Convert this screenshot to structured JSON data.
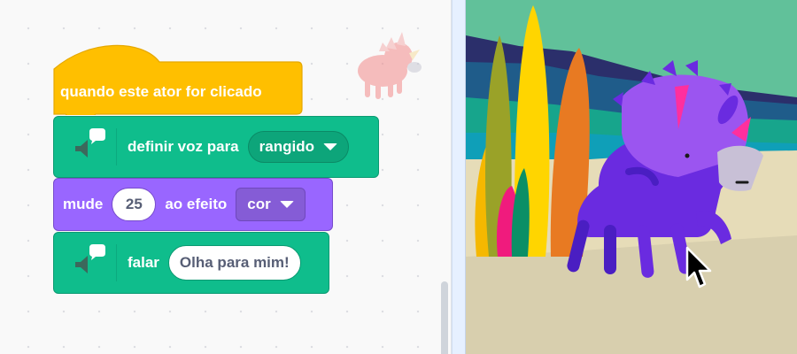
{
  "code_area": {
    "blocks": {
      "event_hat": {
        "label": "quando este ator for clicado",
        "color": "#ffbf00"
      },
      "set_voice": {
        "label": "definir voz para",
        "voice_value": "rangido",
        "icon": "speech-bubble-speaker-icon",
        "color": "#0fbd8c"
      },
      "change_effect": {
        "label_before": "mude",
        "amount": "25",
        "label_after": "ao efeito",
        "effect_value": "cor",
        "color": "#9966ff"
      },
      "speak": {
        "label": "falar",
        "text_value": "Olha para mim!",
        "icon": "speech-bubble-speaker-icon",
        "color": "#0fbd8c"
      }
    }
  },
  "stage": {
    "sprite": "triceratops-sprite",
    "cursor": "pointer-cursor-icon"
  }
}
